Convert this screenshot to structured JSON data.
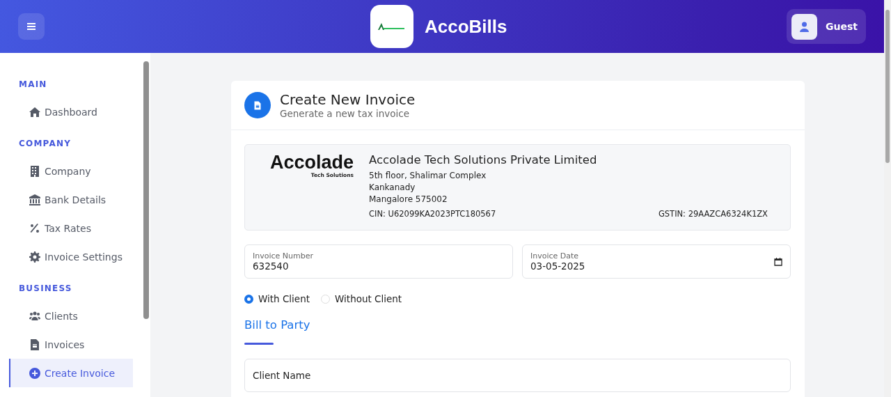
{
  "header": {
    "title": "AccoBills",
    "user": "Guest"
  },
  "sidebar": {
    "sections": [
      {
        "title": "MAIN",
        "items": [
          {
            "label": "Dashboard",
            "kind": "home",
            "selected": false
          }
        ]
      },
      {
        "title": "COMPANY",
        "items": [
          {
            "label": "Company",
            "kind": "building",
            "selected": false
          },
          {
            "label": "Bank Details",
            "kind": "bank",
            "selected": false
          },
          {
            "label": "Tax Rates",
            "kind": "percent",
            "selected": false
          },
          {
            "label": "Invoice Settings",
            "kind": "gear",
            "selected": false
          }
        ]
      },
      {
        "title": "BUSINESS",
        "items": [
          {
            "label": "Clients",
            "kind": "users",
            "selected": false
          },
          {
            "label": "Invoices",
            "kind": "file",
            "selected": false
          },
          {
            "label": "Create Invoice",
            "kind": "plus",
            "selected": true
          }
        ]
      }
    ]
  },
  "page": {
    "title": "Create New Invoice",
    "subtitle": "Generate a new tax invoice"
  },
  "company": {
    "logo_text": "Accolade",
    "logo_tagline": "Tech Solutions",
    "name": "Accolade Tech Solutions Private Limited",
    "address": [
      "5th floor, Shalimar Complex",
      "Kankanady",
      "Mangalore 575002"
    ],
    "cin": "CIN: U62099KA2023PTC180567",
    "gstin": "GSTIN: 29AAZCA6324K1ZX"
  },
  "fields": [
    {
      "label": "Invoice Number",
      "value": "632540",
      "kind": "text"
    },
    {
      "label": "Invoice Date",
      "value": "03-05-2025",
      "kind": "date"
    }
  ],
  "client_mode": [
    {
      "label": "With Client",
      "selected": true
    },
    {
      "label": "Without Client",
      "selected": false
    }
  ],
  "bill_to": {
    "title": "Bill to Party",
    "client_field": {
      "placeholder": "Client Name"
    }
  }
}
